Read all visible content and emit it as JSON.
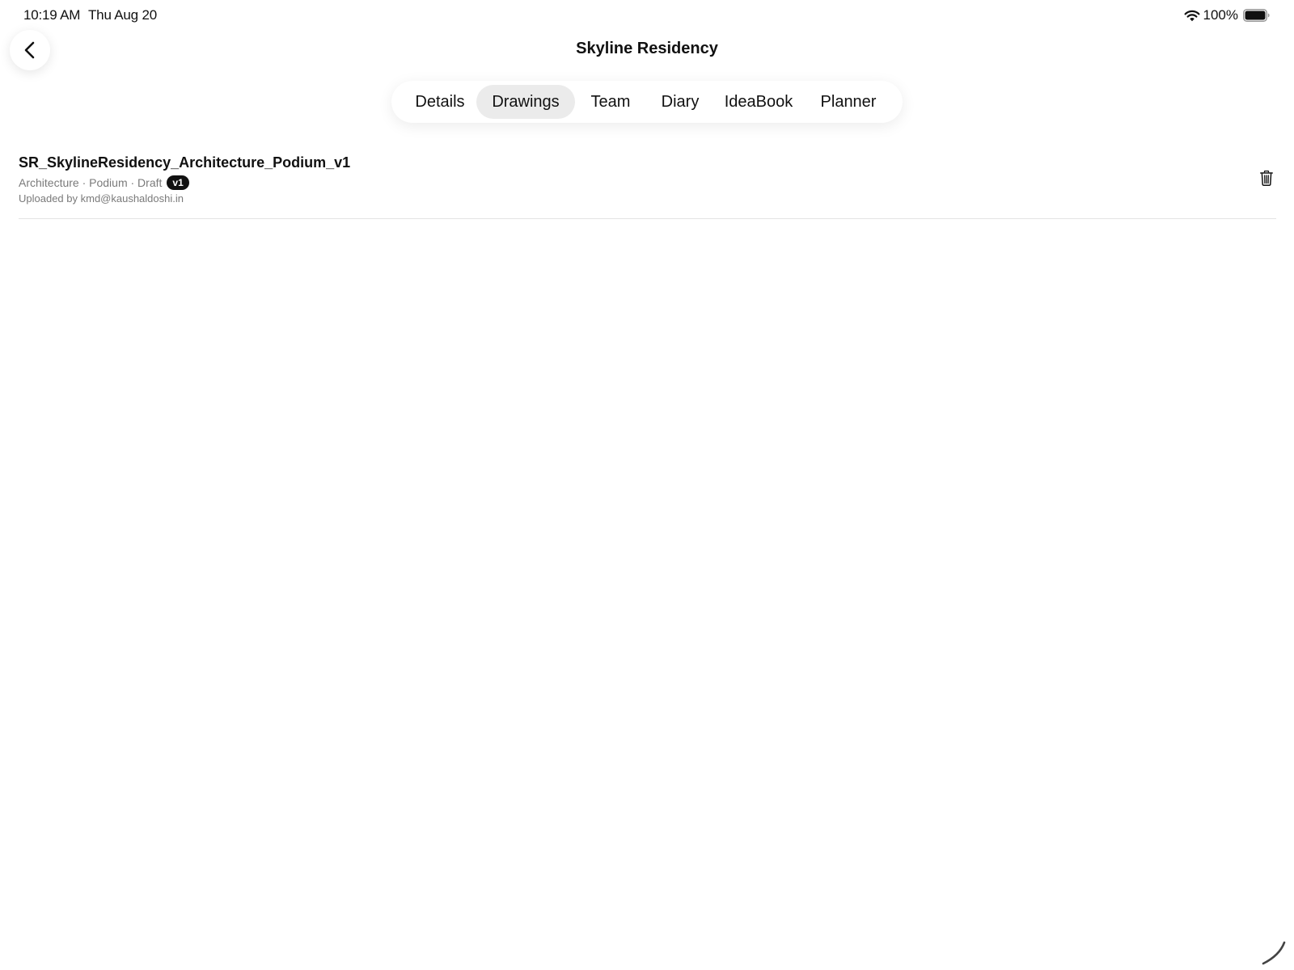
{
  "status_bar": {
    "time": "10:19 AM",
    "date": "Thu Aug 20",
    "battery_percent": "100%",
    "wifi_icon": "wifi-icon",
    "battery_icon": "battery-full-icon"
  },
  "header": {
    "back_icon": "chevron-left-icon",
    "title": "Skyline Residency"
  },
  "tabs": [
    {
      "label": "Details",
      "active": false
    },
    {
      "label": "Drawings",
      "active": true
    },
    {
      "label": "Team",
      "active": false
    },
    {
      "label": "Diary",
      "active": false
    },
    {
      "label": "IdeaBook",
      "active": false
    },
    {
      "label": "Planner",
      "active": false
    }
  ],
  "drawings": [
    {
      "name": "SR_SkylineResidency_Architecture_Podium_v1",
      "meta": "Architecture · Podium · Draft",
      "version": "v1",
      "uploaded_by": "Uploaded by kmd@kaushaldoshi.in",
      "delete_icon": "trash-icon"
    }
  ],
  "colors": {
    "active_tab_bg": "#ebebeb",
    "badge_bg": "#111111",
    "meta_text": "#7a7a7a"
  }
}
